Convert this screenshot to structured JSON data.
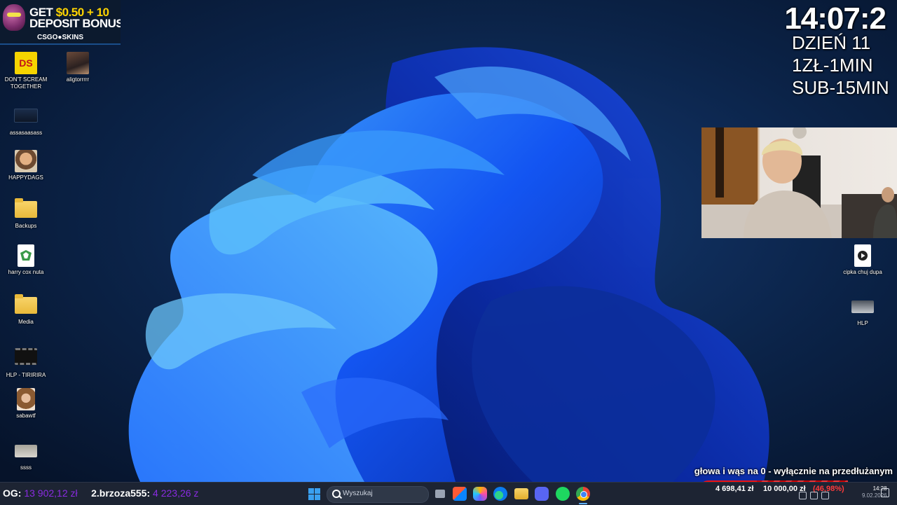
{
  "ad": {
    "line1_prefix": "GET ",
    "line1_amount": "$0.50 + 10",
    "line2": "DEPOSIT BONUS",
    "brand": "CSGO●SKINS"
  },
  "desktop_icons_left": [
    {
      "label": "DON'T SCREAM TOGETHER",
      "icon": "game-icon",
      "badge": "DS"
    },
    {
      "label": "aligtorrrrr",
      "icon": "photo-icon"
    },
    {
      "label": "assasaasass",
      "icon": "screenshot-icon"
    },
    {
      "label": "HAPPYDAGS",
      "icon": "photo-icon"
    },
    {
      "label": "Backups",
      "icon": "folder-icon"
    },
    {
      "label": "harry cox nuta",
      "icon": "file-icon"
    },
    {
      "label": "Media",
      "icon": "folder-icon"
    },
    {
      "label": "HLP - TIRIRIRA",
      "icon": "video-thumbnail-icon"
    },
    {
      "label": "sabawtf",
      "icon": "photo-icon"
    },
    {
      "label": "ssss",
      "icon": "photo-icon"
    }
  ],
  "desktop_icons_right": [
    {
      "label": "cipka chuj dupa",
      "icon": "video-file-icon"
    },
    {
      "label": "HLP",
      "icon": "video-thumbnail-icon"
    }
  ],
  "overlay": {
    "clock": "14:07:2",
    "day": "DZIEŃ 11",
    "rate1": "1ZŁ-1MIN",
    "rate2": "SUB-15MIN",
    "ticker": "głowa i wąs na 0 - wyłącznie na przedłużanym"
  },
  "taskbar": {
    "left_label1": "OG:",
    "left_amount1": "13 902,12 zł",
    "left_label2": "2.brzoza555:",
    "left_amount2": "4 223,26 z",
    "search_placeholder": "Wyszukaj",
    "apps": [
      "task-view-icon",
      "store-icon",
      "copilot-icon",
      "edge-icon",
      "file-explorer-icon",
      "discord-icon",
      "spotify-icon",
      "chrome-icon"
    ],
    "goal_current": "4 698,41 zł",
    "goal_target": "10 000,00 zł",
    "goal_percent": "(46,98%)",
    "time": "14:28",
    "date": "9.02.2026"
  },
  "colors": {
    "accent_blue": "#1a5cff",
    "donation_purple": "#8a2be2",
    "goal_red": "#e11111"
  }
}
